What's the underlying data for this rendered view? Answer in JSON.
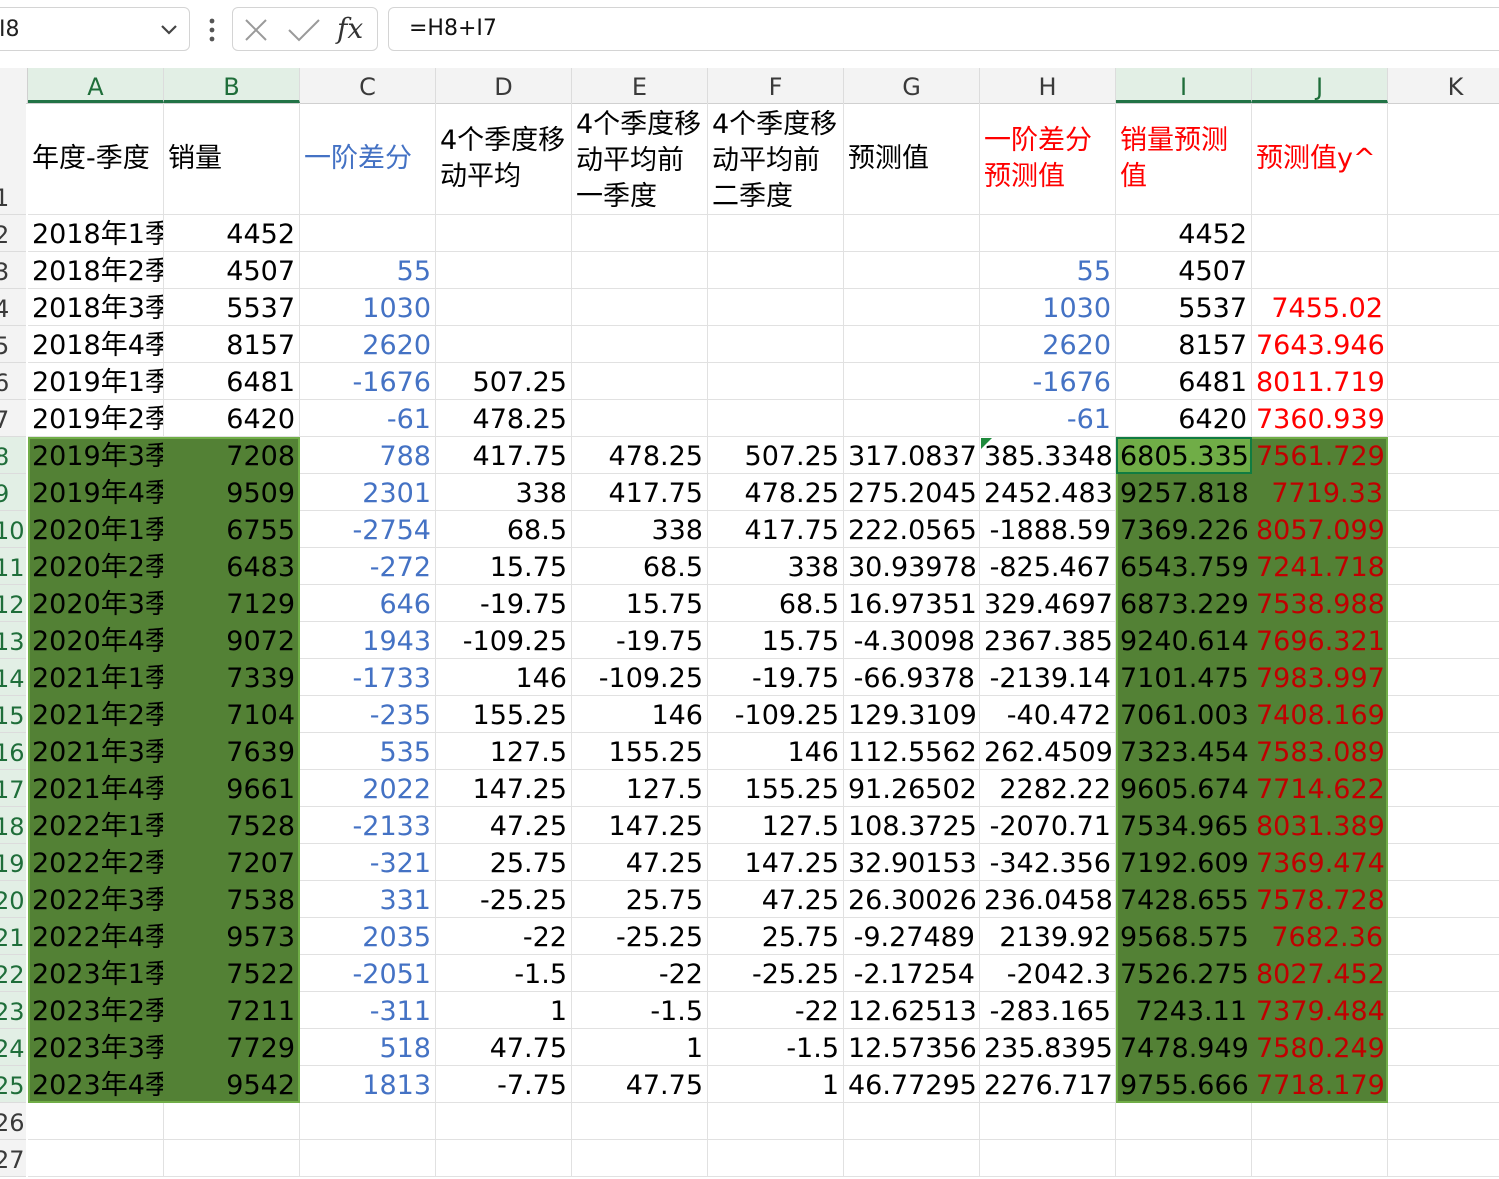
{
  "formula_bar": {
    "name_box": "I8",
    "fx_label": "fx",
    "formula": "=H8+I7"
  },
  "columns": [
    "A",
    "B",
    "C",
    "D",
    "E",
    "F",
    "G",
    "H",
    "I",
    "J",
    "K"
  ],
  "selected_columns": [
    "A",
    "B",
    "I",
    "J"
  ],
  "row_numbers": [
    "1",
    "2",
    "3",
    "4",
    "5",
    "6",
    "7",
    "8",
    "9",
    "10",
    "11",
    "12",
    "13",
    "14",
    "15",
    "16",
    "17",
    "18",
    "19",
    "20",
    "21",
    "22",
    "23",
    "24",
    "25",
    "26",
    "27"
  ],
  "headers": {
    "A": "年度-季度",
    "B": "销量",
    "C": "一阶差分",
    "D": "4个季度移动平均",
    "E": "4个季度移动平均前一季度",
    "F": "4个季度移动平均前二季度",
    "G": "预测值",
    "H": "一阶差分预测值",
    "I": "销量预测值",
    "J": "预测值y^"
  },
  "rows": [
    [
      "2018年1季",
      "4452",
      "",
      "",
      "",
      "",
      "",
      "",
      "4452",
      ""
    ],
    [
      "2018年2季",
      "4507",
      "55",
      "",
      "",
      "",
      "",
      "55",
      "4507",
      ""
    ],
    [
      "2018年3季",
      "5537",
      "1030",
      "",
      "",
      "",
      "",
      "1030",
      "5537",
      "7455.02"
    ],
    [
      "2018年4季",
      "8157",
      "2620",
      "",
      "",
      "",
      "",
      "2620",
      "8157",
      "7643.946"
    ],
    [
      "2019年1季",
      "6481",
      "-1676",
      "507.25",
      "",
      "",
      "",
      "-1676",
      "6481",
      "8011.719"
    ],
    [
      "2019年2季",
      "6420",
      "-61",
      "478.25",
      "",
      "",
      "",
      "-61",
      "6420",
      "7360.939"
    ],
    [
      "2019年3季",
      "7208",
      "788",
      "417.75",
      "478.25",
      "507.25",
      "317.0837",
      "385.3348",
      "6805.335",
      "7561.729"
    ],
    [
      "2019年4季",
      "9509",
      "2301",
      "338",
      "417.75",
      "478.25",
      "275.2045",
      "2452.483",
      "9257.818",
      "7719.33"
    ],
    [
      "2020年1季",
      "6755",
      "-2754",
      "68.5",
      "338",
      "417.75",
      "222.0565",
      "-1888.59",
      "7369.226",
      "8057.099"
    ],
    [
      "2020年2季",
      "6483",
      "-272",
      "15.75",
      "68.5",
      "338",
      "30.93978",
      "-825.467",
      "6543.759",
      "7241.718"
    ],
    [
      "2020年3季",
      "7129",
      "646",
      "-19.75",
      "15.75",
      "68.5",
      "16.97351",
      "329.4697",
      "6873.229",
      "7538.988"
    ],
    [
      "2020年4季",
      "9072",
      "1943",
      "-109.25",
      "-19.75",
      "15.75",
      "-4.30098",
      "2367.385",
      "9240.614",
      "7696.321"
    ],
    [
      "2021年1季",
      "7339",
      "-1733",
      "146",
      "-109.25",
      "-19.75",
      "-66.9378",
      "-2139.14",
      "7101.475",
      "7983.997"
    ],
    [
      "2021年2季",
      "7104",
      "-235",
      "155.25",
      "146",
      "-109.25",
      "129.3109",
      "-40.472",
      "7061.003",
      "7408.169"
    ],
    [
      "2021年3季",
      "7639",
      "535",
      "127.5",
      "155.25",
      "146",
      "112.5562",
      "262.4509",
      "7323.454",
      "7583.089"
    ],
    [
      "2021年4季",
      "9661",
      "2022",
      "147.25",
      "127.5",
      "155.25",
      "91.26502",
      "2282.22",
      "9605.674",
      "7714.622"
    ],
    [
      "2022年1季",
      "7528",
      "-2133",
      "47.25",
      "147.25",
      "127.5",
      "108.3725",
      "-2070.71",
      "7534.965",
      "8031.389"
    ],
    [
      "2022年2季",
      "7207",
      "-321",
      "25.75",
      "47.25",
      "147.25",
      "32.90153",
      "-342.356",
      "7192.609",
      "7369.474"
    ],
    [
      "2022年3季",
      "7538",
      "331",
      "-25.25",
      "25.75",
      "47.25",
      "26.30026",
      "236.0458",
      "7428.655",
      "7578.728"
    ],
    [
      "2022年4季",
      "9573",
      "2035",
      "-22",
      "-25.25",
      "25.75",
      "-9.27489",
      "2139.92",
      "9568.575",
      "7682.36"
    ],
    [
      "2023年1季",
      "7522",
      "-2051",
      "-1.5",
      "-22",
      "-25.25",
      "-2.17254",
      "-2042.3",
      "7526.275",
      "8027.452"
    ],
    [
      "2023年2季",
      "7211",
      "-311",
      "1",
      "-1.5",
      "-22",
      "12.62513",
      "-283.165",
      "7243.11",
      "7379.484"
    ],
    [
      "2023年3季",
      "7729",
      "518",
      "47.75",
      "1",
      "-1.5",
      "12.57356",
      "235.8395",
      "7478.949",
      "7580.249"
    ],
    [
      "2023年4季",
      "9542",
      "1813",
      "-7.75",
      "47.75",
      "1",
      "46.77295",
      "2276.717",
      "9755.666",
      "7718.179"
    ]
  ],
  "colors": {
    "selection_fill": "#538135",
    "active_cell_fill": "#70ad47",
    "blue_text": "#4472c4",
    "red_text": "#ff0000",
    "grid_line": "#e1e1e1"
  }
}
